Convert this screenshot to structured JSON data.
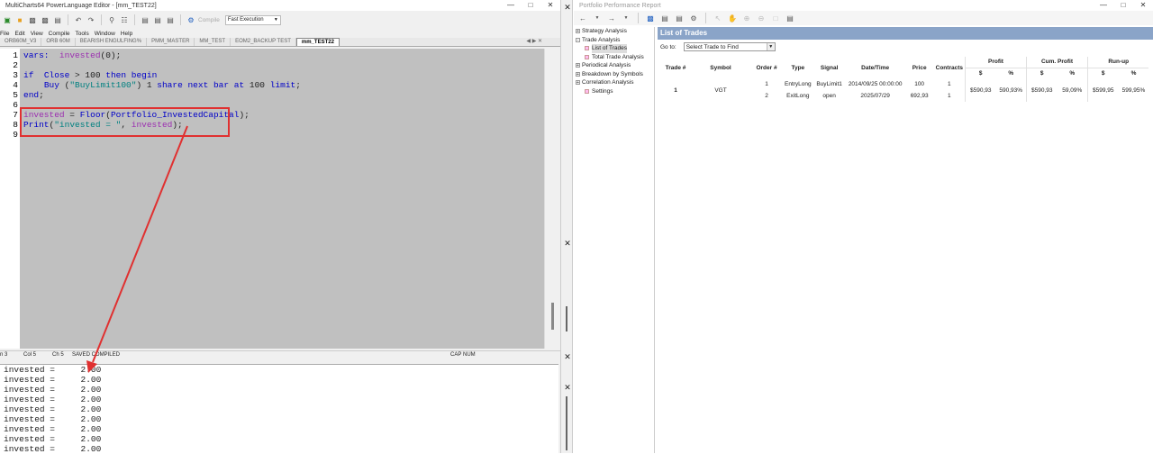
{
  "editor_window": {
    "title": "MultiCharts64 PowerLanguage Editor - [mm_TEST22]",
    "compile_label": "Compile",
    "execution_mode": "Fast Execution",
    "menu": [
      "File",
      "Edit",
      "View",
      "Compile",
      "Tools",
      "Window",
      "Help"
    ],
    "tabs": [
      "ORB60M_V3",
      "ORB 60M",
      "BEARISH ENGULFING%",
      "PMM_MASTER",
      "MM_TEST",
      "EOM2_BACKUP TEST",
      "mm_TEST22"
    ],
    "active_tab_index": 6,
    "code_lines": [
      {
        "n": "1",
        "parts": [
          [
            "kw",
            "vars:"
          ],
          [
            "",
            "  "
          ],
          [
            "var",
            "invested"
          ],
          [
            "",
            "(0);"
          ]
        ]
      },
      {
        "n": "2",
        "parts": []
      },
      {
        "n": "3",
        "parts": [
          [
            "kw",
            "if"
          ],
          [
            "",
            "  "
          ],
          [
            "kw",
            "Close"
          ],
          [
            "",
            " > 100 "
          ],
          [
            "kw",
            "then"
          ],
          [
            "",
            " "
          ],
          [
            "kw",
            "begin"
          ]
        ]
      },
      {
        "n": "4",
        "parts": [
          [
            "",
            "    "
          ],
          [
            "kw",
            "Buy"
          ],
          [
            "",
            " ("
          ],
          [
            "str",
            "\"BuyLimit100\""
          ],
          [
            "",
            ") 1 "
          ],
          [
            "kw",
            "share next bar"
          ],
          [
            "",
            " "
          ],
          [
            "kw",
            "at"
          ],
          [
            "",
            " 100 "
          ],
          [
            "kw",
            "limit"
          ],
          [
            "",
            ";"
          ]
        ]
      },
      {
        "n": "5",
        "parts": [
          [
            "kw",
            "end"
          ],
          [
            "",
            ";"
          ]
        ]
      },
      {
        "n": "6",
        "parts": []
      },
      {
        "n": "7",
        "parts": [
          [
            "var",
            "invested"
          ],
          [
            "",
            " = "
          ],
          [
            "fn",
            "Floor"
          ],
          [
            "",
            "("
          ],
          [
            "kw",
            "Portfolio_InvestedCapital"
          ],
          [
            "",
            ");"
          ]
        ]
      },
      {
        "n": "8",
        "parts": [
          [
            "fn",
            "Print"
          ],
          [
            "",
            "("
          ],
          [
            "str",
            "\"invested = \""
          ],
          [
            "",
            ", "
          ],
          [
            "var",
            "invested"
          ],
          [
            "",
            ");"
          ]
        ]
      },
      {
        "n": "9",
        "parts": []
      }
    ],
    "status": {
      "ln": "n 3",
      "col": "Col 5",
      "ch": "Ch 5",
      "state": "SAVED COMPILED",
      "caps": "CAP",
      "num": "NUM"
    },
    "output_lines": [
      "invested =     2.00",
      "invested =     2.00",
      "invested =     2.00",
      "invested =     2.00",
      "invested =     2.00",
      "invested =     2.00",
      "invested =     2.00",
      "invested =     2.00",
      "invested =     2.00"
    ],
    "annotation_color": "#e03030"
  },
  "report_window": {
    "title": "Portfolio Performance Report",
    "tree": [
      {
        "label": "Strategy Analysis",
        "kind": "node",
        "level": 0,
        "sign": "+"
      },
      {
        "label": "Trade Analysis",
        "kind": "node",
        "level": 0,
        "sign": "-"
      },
      {
        "label": "List of Trades",
        "kind": "leaf",
        "level": 1,
        "selected": true
      },
      {
        "label": "Total Trade Analysis",
        "kind": "leaf",
        "level": 1
      },
      {
        "label": "Periodical Analysis",
        "kind": "node",
        "level": 0,
        "sign": "+"
      },
      {
        "label": "Breakdown by Symbols",
        "kind": "node",
        "level": 0,
        "sign": "+"
      },
      {
        "label": "Correlation Analysis",
        "kind": "node",
        "level": 0,
        "sign": "+"
      },
      {
        "label": "Settings",
        "kind": "leaf",
        "level": 1
      }
    ],
    "header": "List of Trades",
    "goto_label": "Go to:",
    "goto_select": "Select Trade to Find",
    "columns": {
      "trade": "Trade #",
      "symbol": "Symbol",
      "order": "Order #",
      "type": "Type",
      "signal": "Signal",
      "datetime": "Date/Time",
      "price": "Price",
      "contracts": "Contracts",
      "profit": "Profit",
      "cum_profit": "Cum. Profit",
      "runup": "Run-up",
      "usd": "$",
      "pct": "%"
    },
    "trade": {
      "num": "1",
      "symbol": "VGT",
      "rows": [
        {
          "order": "1",
          "type": "EntryLong",
          "signal": "BuyLimit1",
          "datetime": "2014/09/25 00:00:00",
          "price": "100",
          "contracts": "1"
        },
        {
          "order": "2",
          "type": "ExitLong",
          "signal": "open",
          "datetime": "2025/07/29",
          "price": "692,93",
          "contracts": "1"
        }
      ],
      "profit_usd": "$590,93",
      "profit_pct": "590,93%",
      "cum_usd": "$590,93",
      "cum_pct": "59,09%",
      "runup_usd": "$599,95",
      "runup_pct": "599,95%"
    }
  }
}
